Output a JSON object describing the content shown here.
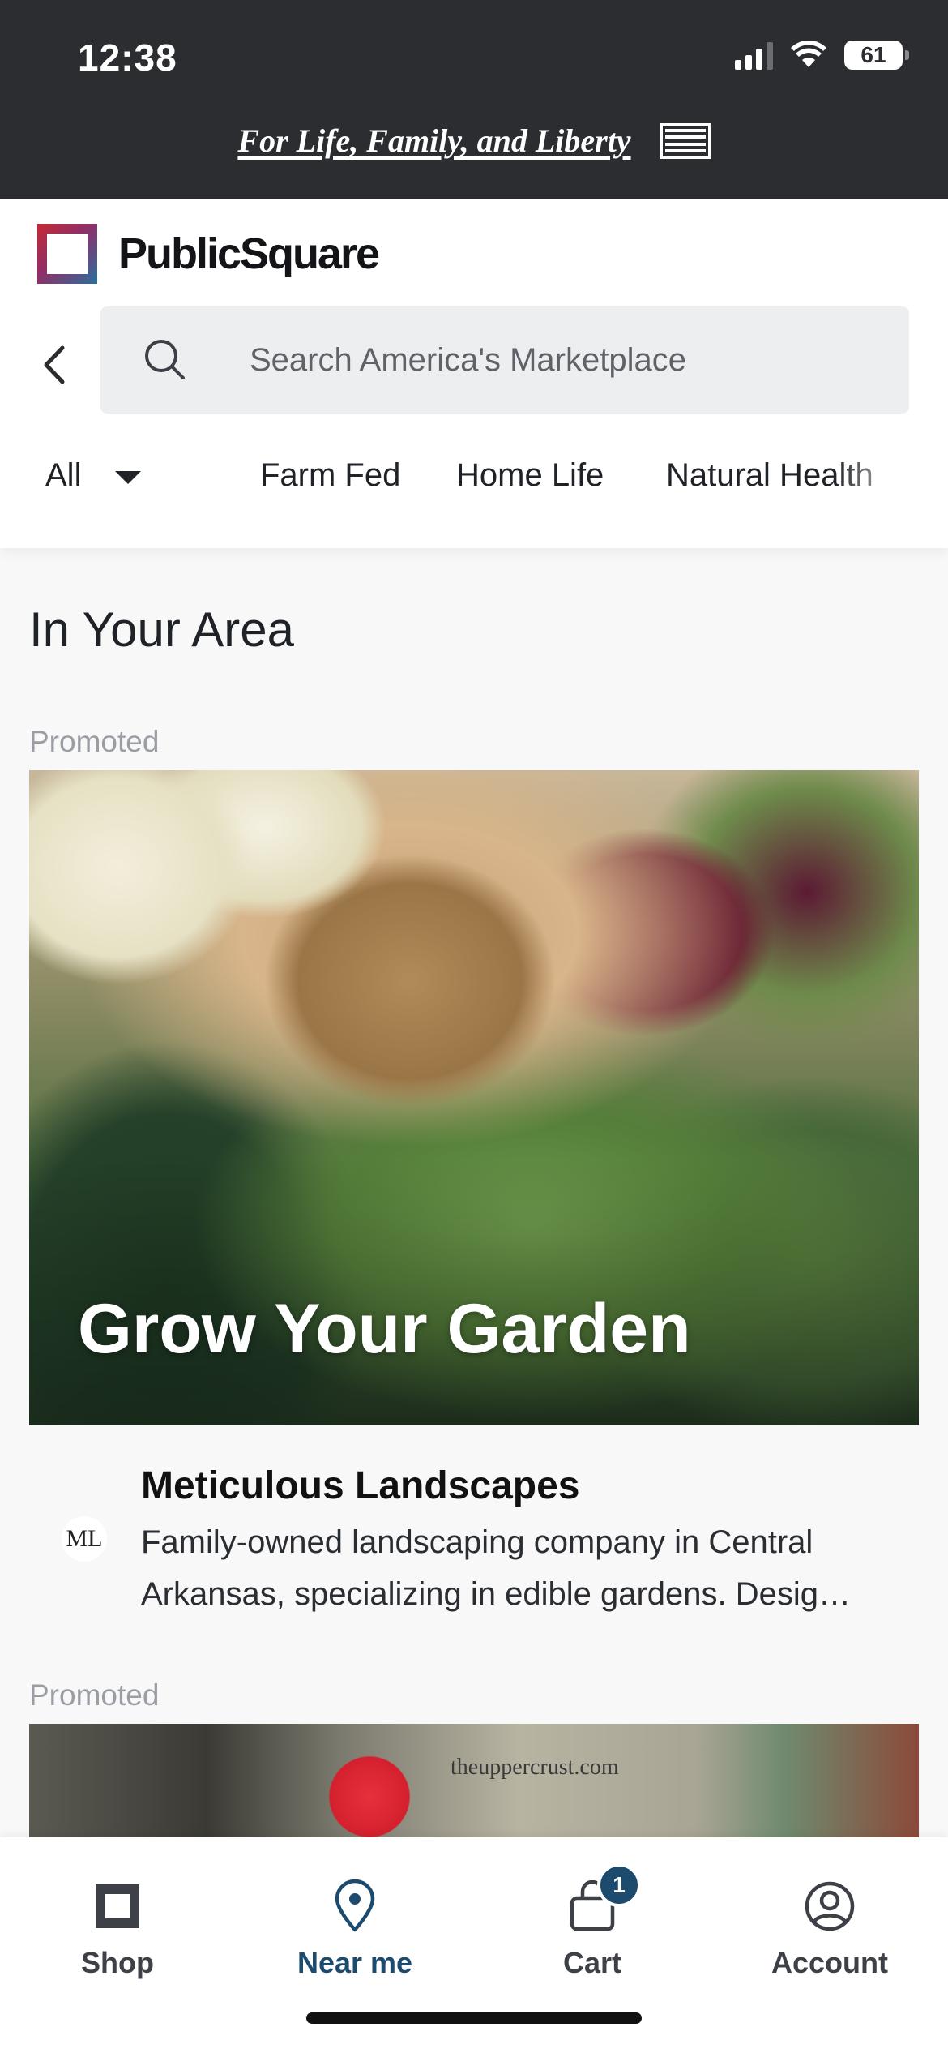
{
  "status_bar": {
    "time": "12:38",
    "battery": "61"
  },
  "banner": {
    "motto": "For Life, Family, and Liberty"
  },
  "header": {
    "brand": "PublicSquare",
    "search": {
      "placeholder": "Search America's Marketplace"
    },
    "categories": {
      "selected": "All",
      "items": [
        "Farm Fed",
        "Home Life",
        "Natural Health"
      ]
    }
  },
  "main": {
    "section_title": "In Your Area",
    "cards": [
      {
        "label": "Promoted",
        "headline": "Grow Your Garden",
        "business_logo_text": "ML",
        "business_name": "Meticulous Landscapes",
        "description": "Family-owned landscaping company in Central Arkansas, specializing in edible gardens. Desig…"
      },
      {
        "label": "Promoted",
        "image_text": "theuppercrust.com"
      }
    ]
  },
  "bottom_nav": {
    "items": [
      {
        "label": "Shop",
        "icon": "shop-icon"
      },
      {
        "label": "Near me",
        "icon": "map-pin-icon",
        "active": true
      },
      {
        "label": "Cart",
        "icon": "cart-icon",
        "badge": "1"
      },
      {
        "label": "Account",
        "icon": "account-icon"
      }
    ]
  },
  "colors": {
    "banner_bg": "#2b2d31",
    "accent": "#1d4b6e",
    "brand_red": "#c52a35",
    "brand_blue": "#2a6f9b"
  }
}
